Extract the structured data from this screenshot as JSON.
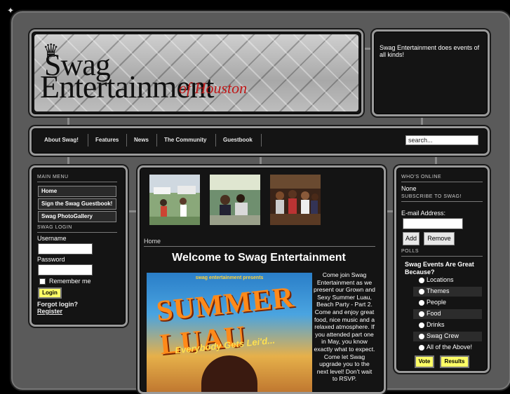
{
  "header": {
    "logo_line1": "Swag",
    "logo_line2": "Entertainment",
    "logo_line3": "of Houston",
    "tagline": "Swag Entertainment does events of all kinds!"
  },
  "nav": {
    "items": [
      "About Swag!",
      "Features",
      "News",
      "The Community",
      "Guestbook"
    ],
    "search_placeholder": "search..."
  },
  "left": {
    "main_menu_title": "MAIN MENU",
    "menu": [
      "Home",
      "Sign the Swag Guestbook!",
      "Swag PhotoGallery"
    ],
    "login_title": "SWAG LOGIN",
    "username_label": "Username",
    "password_label": "Password",
    "remember_label": "Remember me",
    "login_button": "Login",
    "forgot_link": "Forgot login?",
    "register_link": "Register"
  },
  "center": {
    "breadcrumb": "Home",
    "heading": "Welcome to Swag Entertainment",
    "poster_top": "swag entertainment presents",
    "poster_title": "SUMMER LUAU",
    "poster_sub": "Everybody Gets Lei'd...",
    "body": "Come join Swag Entertainment as we present our Grown and Sexy Summer Luau, Beach Party - Part 2. Come and enjoy great food, nice music and a relaxed atmosphere. If you attended part one in May, you know exactly what to expect. Come let Swag upgrade you to the next level! Don't wait to RSVP."
  },
  "right": {
    "whos_online_title": "WHO'S ONLINE",
    "whos_online_value": "None",
    "subscribe_title": "SUBSCRIBE TO SWAG!",
    "email_label": "E-mail Address:",
    "add_button": "Add",
    "remove_button": "Remove",
    "polls_title": "POLLS",
    "poll_question": "Swag Events Are Great Because?",
    "poll_options": [
      "Locations",
      "Themes",
      "People",
      "Food",
      "Drinks",
      "Swag Crew",
      "All of the Above!"
    ],
    "vote_button": "Vote",
    "results_button": "Results"
  }
}
